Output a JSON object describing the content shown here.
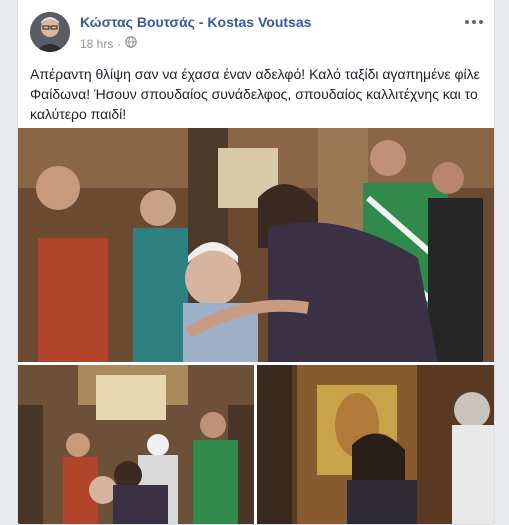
{
  "post": {
    "author_name": "Κώστας Βουτσάς - Kostas Voutsas",
    "timestamp": "18 hrs",
    "separator": "·",
    "privacy_icon": "globe-icon",
    "more_icon": "more-options-icon",
    "text": "Απέραντη θλίψη σαν να έχασα έναν αδελφό! Καλό ταξίδι αγαπημένε φίλε Φαίδωνα! Ήσουν σπουδαίος συνάδελφος, σπουδαίος καλλιτέχνης και το καλύτερο παιδί!"
  },
  "colors": {
    "link": "#385898",
    "text": "#1d2129",
    "meta": "#90949c",
    "background": "#e9ebee",
    "card": "#ffffff"
  }
}
